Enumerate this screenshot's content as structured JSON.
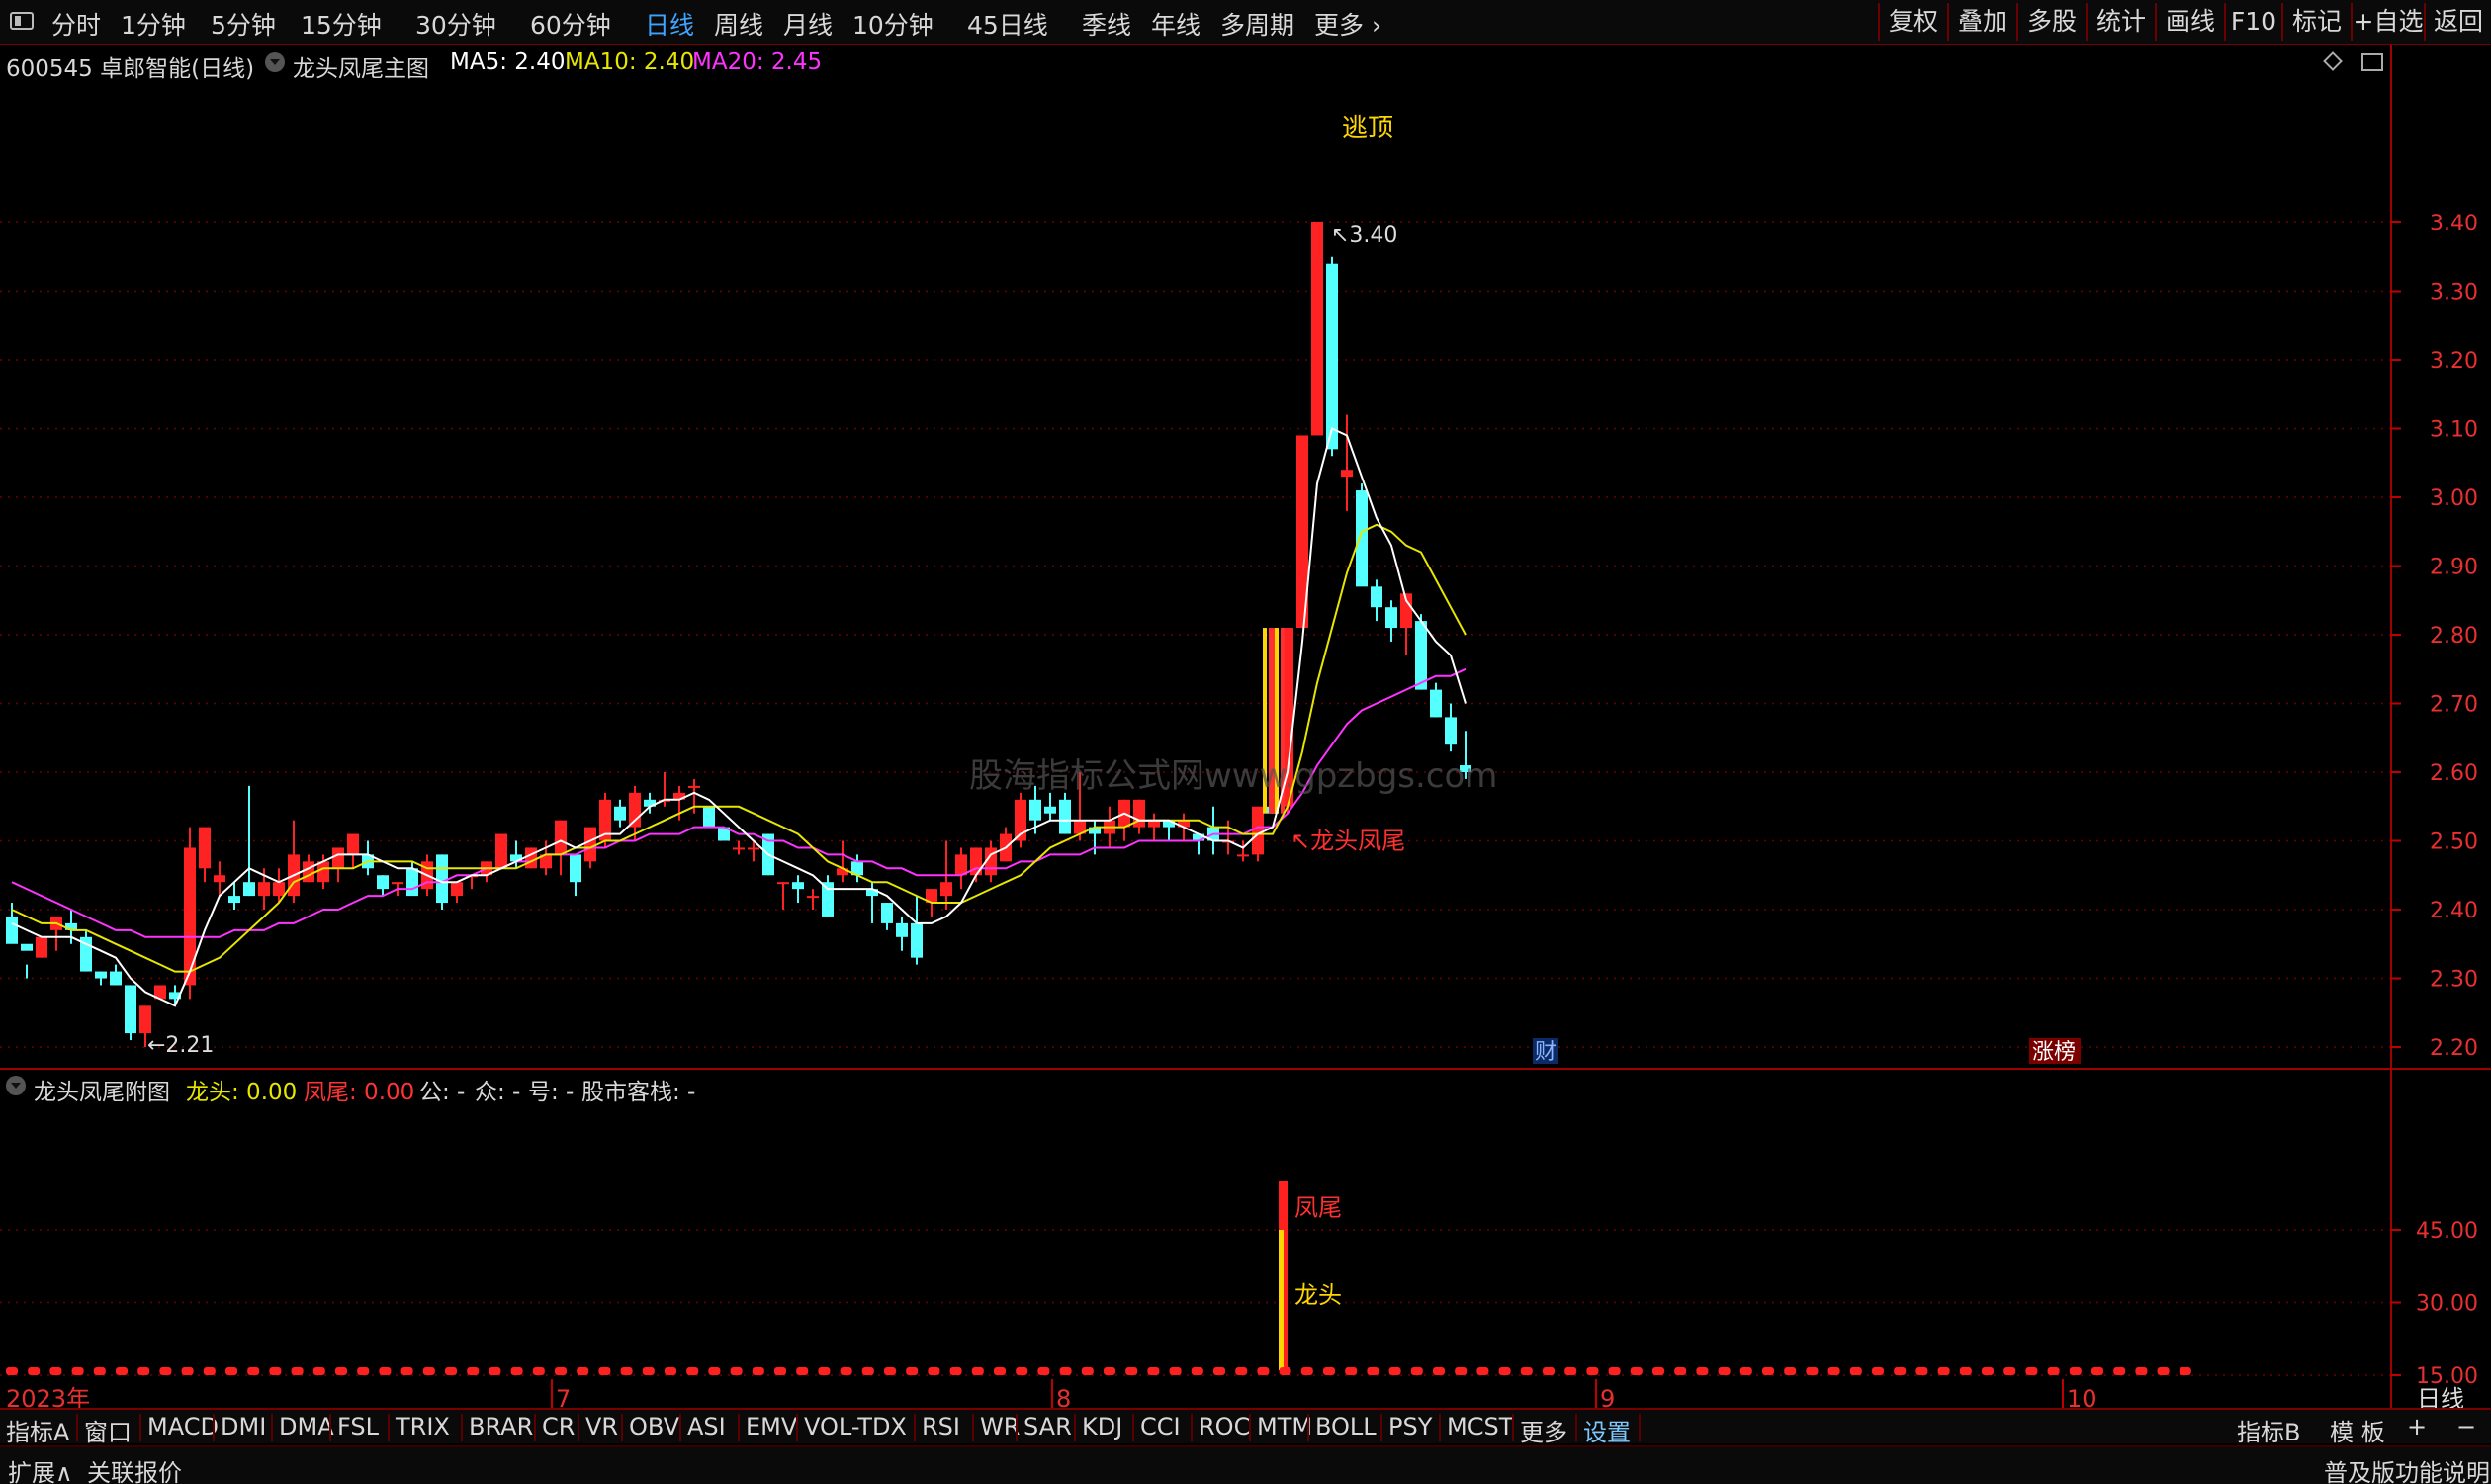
{
  "toolbar": {
    "periods": [
      "分时",
      "1分钟",
      "5分钟",
      "15分钟",
      "30分钟",
      "60分钟",
      "日线",
      "周线",
      "月线",
      "10分钟",
      "45日线",
      "季线",
      "年线",
      "多周期",
      "更多"
    ],
    "active_period": "日线",
    "right_buttons": [
      "复权",
      "叠加",
      "多股",
      "统计",
      "画线",
      "F10",
      "标记",
      "+自选",
      "返回"
    ]
  },
  "main_chart": {
    "stock": "600545 卓郎智能(日线)",
    "indicator_name": "龙头凤尾主图",
    "ma5_label": "MA5: 2.40",
    "ma10_label": "MA10: 2.40",
    "ma20_label": "MA20: 2.45",
    "annotation_top": "逃顶",
    "high_label": "3.40",
    "low_label": "2.21",
    "signal_label": "↖龙头凤尾",
    "watermark": "股海指标公式网www.gpzbgs.com",
    "event_finance": "财",
    "event_limit": "涨榜"
  },
  "sub_chart": {
    "title": "龙头凤尾附图",
    "longtou_label": "龙头: 0.00",
    "fengwei_label": "凤尾: 0.00",
    "gong_label": "公: -",
    "zhong_label": "众: -",
    "hao_label": "号: -",
    "gushi_label": "股市客栈: -",
    "bar_label_top": "凤尾",
    "bar_label_mid": "龙头"
  },
  "time_axis": {
    "year": "2023年",
    "months": [
      "7",
      "8",
      "9",
      "10"
    ],
    "period_right": "日线"
  },
  "chart_data": {
    "type": "candlestick",
    "main_y_ticks": [
      3.4,
      3.3,
      3.2,
      3.1,
      3.0,
      2.9,
      2.8,
      2.7,
      2.6,
      2.5,
      2.4,
      2.3,
      2.2
    ],
    "main_ylim": [
      2.17,
      3.45
    ],
    "sub_y_ticks": [
      45.0,
      30.0,
      15.0
    ],
    "sub_ylim": [
      0,
      57
    ],
    "candles": [
      [
        2.39,
        2.41,
        2.36,
        2.35
      ],
      [
        2.35,
        2.32,
        2.3,
        2.34
      ],
      [
        2.33,
        2.35,
        2.33,
        2.36
      ],
      [
        2.37,
        2.38,
        2.34,
        2.39
      ],
      [
        2.38,
        2.4,
        2.35,
        2.37
      ],
      [
        2.36,
        2.37,
        2.31,
        2.31
      ],
      [
        2.31,
        2.31,
        2.29,
        2.3
      ],
      [
        2.31,
        2.32,
        2.29,
        2.29
      ],
      [
        2.29,
        2.29,
        2.21,
        2.22
      ],
      [
        2.22,
        2.24,
        2.2,
        2.26
      ],
      [
        2.27,
        2.24,
        2.24,
        2.29
      ],
      [
        2.28,
        2.29,
        2.26,
        2.27
      ],
      [
        2.29,
        2.52,
        2.27,
        2.49
      ],
      [
        2.46,
        2.52,
        2.44,
        2.52
      ],
      [
        2.44,
        2.47,
        2.42,
        2.45
      ],
      [
        2.42,
        2.44,
        2.4,
        2.41
      ],
      [
        2.44,
        2.58,
        2.42,
        2.42
      ],
      [
        2.42,
        2.46,
        2.4,
        2.44
      ],
      [
        2.42,
        2.46,
        2.41,
        2.44
      ],
      [
        2.42,
        2.53,
        2.41,
        2.48
      ],
      [
        2.44,
        2.48,
        2.44,
        2.47
      ],
      [
        2.44,
        2.48,
        2.43,
        2.47
      ],
      [
        2.46,
        2.48,
        2.44,
        2.49
      ],
      [
        2.48,
        2.51,
        2.46,
        2.51
      ],
      [
        2.48,
        2.5,
        2.45,
        2.46
      ],
      [
        2.45,
        2.45,
        2.42,
        2.43
      ],
      [
        2.44,
        2.44,
        2.42,
        2.44
      ],
      [
        2.46,
        2.47,
        2.43,
        2.42
      ],
      [
        2.43,
        2.48,
        2.42,
        2.47
      ],
      [
        2.48,
        2.48,
        2.4,
        2.41
      ],
      [
        2.42,
        2.44,
        2.41,
        2.44
      ],
      [
        2.45,
        2.45,
        2.43,
        2.45
      ],
      [
        2.45,
        2.47,
        2.44,
        2.47
      ],
      [
        2.46,
        2.51,
        2.46,
        2.51
      ],
      [
        2.48,
        2.5,
        2.46,
        2.47
      ],
      [
        2.46,
        2.49,
        2.46,
        2.49
      ],
      [
        2.46,
        2.5,
        2.45,
        2.48
      ],
      [
        2.48,
        2.53,
        2.45,
        2.53
      ],
      [
        2.48,
        2.48,
        2.42,
        2.44
      ],
      [
        2.47,
        2.51,
        2.46,
        2.52
      ],
      [
        2.5,
        2.57,
        2.49,
        2.56
      ],
      [
        2.55,
        2.56,
        2.52,
        2.53
      ],
      [
        2.52,
        2.58,
        2.5,
        2.57
      ],
      [
        2.56,
        2.57,
        2.54,
        2.55
      ],
      [
        2.56,
        2.6,
        2.55,
        2.56
      ],
      [
        2.56,
        2.58,
        2.53,
        2.57
      ],
      [
        2.58,
        2.59,
        2.54,
        2.58
      ],
      [
        2.55,
        2.55,
        2.52,
        2.52
      ],
      [
        2.52,
        2.52,
        2.5,
        2.5
      ],
      [
        2.49,
        2.5,
        2.48,
        2.49
      ],
      [
        2.49,
        2.5,
        2.47,
        2.49
      ],
      [
        2.51,
        2.51,
        2.45,
        2.45
      ],
      [
        2.44,
        2.44,
        2.4,
        2.44
      ],
      [
        2.44,
        2.45,
        2.41,
        2.43
      ],
      [
        2.42,
        2.43,
        2.4,
        2.42
      ],
      [
        2.44,
        2.45,
        2.39,
        2.39
      ],
      [
        2.45,
        2.5,
        2.44,
        2.46
      ],
      [
        2.47,
        2.48,
        2.44,
        2.45
      ],
      [
        2.43,
        2.44,
        2.38,
        2.42
      ],
      [
        2.41,
        2.41,
        2.37,
        2.38
      ],
      [
        2.38,
        2.39,
        2.34,
        2.36
      ],
      [
        2.38,
        2.42,
        2.32,
        2.33
      ],
      [
        2.41,
        2.43,
        2.39,
        2.43
      ],
      [
        2.42,
        2.5,
        2.4,
        2.44
      ],
      [
        2.45,
        2.49,
        2.43,
        2.48
      ],
      [
        2.45,
        2.49,
        2.44,
        2.49
      ],
      [
        2.45,
        2.5,
        2.44,
        2.49
      ],
      [
        2.47,
        2.52,
        2.47,
        2.51
      ],
      [
        2.5,
        2.57,
        2.49,
        2.56
      ],
      [
        2.56,
        2.58,
        2.51,
        2.53
      ],
      [
        2.55,
        2.57,
        2.53,
        2.54
      ],
      [
        2.56,
        2.57,
        2.51,
        2.51
      ],
      [
        2.51,
        2.6,
        2.5,
        2.53
      ],
      [
        2.52,
        2.53,
        2.48,
        2.51
      ],
      [
        2.51,
        2.55,
        2.49,
        2.53
      ],
      [
        2.52,
        2.56,
        2.5,
        2.56
      ],
      [
        2.52,
        2.56,
        2.51,
        2.56
      ],
      [
        2.52,
        2.54,
        2.5,
        2.53
      ],
      [
        2.53,
        2.53,
        2.5,
        2.52
      ],
      [
        2.52,
        2.54,
        2.5,
        2.53
      ],
      [
        2.51,
        2.51,
        2.48,
        2.5
      ],
      [
        2.52,
        2.55,
        2.48,
        2.5
      ],
      [
        2.5,
        2.53,
        2.48,
        2.5
      ],
      [
        2.48,
        2.5,
        2.47,
        2.48
      ],
      [
        2.48,
        2.55,
        2.47,
        2.55
      ],
      [
        2.55,
        2.62,
        2.54,
        2.54
      ],
      [
        2.55,
        2.81,
        2.54,
        2.81
      ],
      [
        2.81,
        3.09,
        2.81,
        3.09
      ],
      [
        3.09,
        3.4,
        3.09,
        3.4
      ],
      [
        3.34,
        3.35,
        3.06,
        3.07
      ],
      [
        3.03,
        3.12,
        2.98,
        3.04
      ],
      [
        3.01,
        3.02,
        2.88,
        2.87
      ],
      [
        2.87,
        2.88,
        2.82,
        2.84
      ],
      [
        2.84,
        2.85,
        2.79,
        2.81
      ],
      [
        2.81,
        2.86,
        2.77,
        2.86
      ],
      [
        2.82,
        2.83,
        2.72,
        2.72
      ],
      [
        2.72,
        2.73,
        2.68,
        2.68
      ],
      [
        2.68,
        2.7,
        2.63,
        2.64
      ],
      [
        2.61,
        2.66,
        2.59,
        2.6
      ]
    ],
    "candle_order": "open,high,low,close",
    "ma5": [
      2.38,
      2.37,
      2.36,
      2.36,
      2.36,
      2.35,
      2.34,
      2.33,
      2.3,
      2.28,
      2.27,
      2.26,
      2.31,
      2.37,
      2.42,
      2.44,
      2.46,
      2.45,
      2.44,
      2.45,
      2.46,
      2.47,
      2.48,
      2.48,
      2.48,
      2.47,
      2.46,
      2.46,
      2.45,
      2.44,
      2.44,
      2.45,
      2.45,
      2.46,
      2.47,
      2.48,
      2.49,
      2.5,
      2.49,
      2.5,
      2.51,
      2.51,
      2.53,
      2.55,
      2.56,
      2.56,
      2.57,
      2.56,
      2.54,
      2.52,
      2.5,
      2.48,
      2.47,
      2.46,
      2.45,
      2.43,
      2.43,
      2.43,
      2.43,
      2.42,
      2.4,
      2.38,
      2.38,
      2.39,
      2.41,
      2.45,
      2.48,
      2.49,
      2.51,
      2.52,
      2.53,
      2.53,
      2.53,
      2.53,
      2.53,
      2.54,
      2.53,
      2.53,
      2.53,
      2.52,
      2.51,
      2.5,
      2.5,
      2.49,
      2.51,
      2.52,
      2.6,
      2.79,
      3.02,
      3.1,
      3.09,
      3.03,
      2.97,
      2.93,
      2.85,
      2.82,
      2.79,
      2.77,
      2.7
    ],
    "ma10": [
      2.4,
      2.39,
      2.38,
      2.38,
      2.37,
      2.37,
      2.36,
      2.35,
      2.34,
      2.33,
      2.32,
      2.31,
      2.31,
      2.32,
      2.33,
      2.35,
      2.37,
      2.39,
      2.41,
      2.44,
      2.45,
      2.46,
      2.46,
      2.46,
      2.47,
      2.47,
      2.47,
      2.47,
      2.46,
      2.46,
      2.46,
      2.46,
      2.46,
      2.46,
      2.46,
      2.47,
      2.48,
      2.48,
      2.49,
      2.49,
      2.5,
      2.5,
      2.51,
      2.52,
      2.53,
      2.54,
      2.55,
      2.55,
      2.55,
      2.55,
      2.54,
      2.53,
      2.52,
      2.51,
      2.49,
      2.47,
      2.46,
      2.45,
      2.44,
      2.44,
      2.43,
      2.42,
      2.41,
      2.41,
      2.41,
      2.42,
      2.43,
      2.44,
      2.45,
      2.47,
      2.49,
      2.5,
      2.51,
      2.52,
      2.52,
      2.52,
      2.53,
      2.53,
      2.53,
      2.53,
      2.53,
      2.52,
      2.52,
      2.51,
      2.51,
      2.51,
      2.55,
      2.63,
      2.73,
      2.81,
      2.89,
      2.95,
      2.96,
      2.95,
      2.93,
      2.92,
      2.88,
      2.84,
      2.8
    ],
    "ma20": [
      2.44,
      2.43,
      2.42,
      2.41,
      2.4,
      2.39,
      2.38,
      2.37,
      2.37,
      2.36,
      2.36,
      2.36,
      2.36,
      2.36,
      2.36,
      2.37,
      2.37,
      2.37,
      2.38,
      2.38,
      2.39,
      2.4,
      2.4,
      2.41,
      2.42,
      2.42,
      2.43,
      2.43,
      2.44,
      2.44,
      2.45,
      2.45,
      2.46,
      2.46,
      2.47,
      2.47,
      2.48,
      2.48,
      2.48,
      2.49,
      2.49,
      2.5,
      2.5,
      2.51,
      2.51,
      2.51,
      2.52,
      2.52,
      2.52,
      2.51,
      2.51,
      2.5,
      2.5,
      2.49,
      2.49,
      2.48,
      2.48,
      2.47,
      2.47,
      2.46,
      2.46,
      2.45,
      2.45,
      2.45,
      2.45,
      2.46,
      2.46,
      2.46,
      2.47,
      2.47,
      2.48,
      2.48,
      2.48,
      2.49,
      2.49,
      2.49,
      2.5,
      2.5,
      2.5,
      2.5,
      2.5,
      2.51,
      2.51,
      2.51,
      2.52,
      2.52,
      2.54,
      2.57,
      2.61,
      2.64,
      2.67,
      2.69,
      2.7,
      2.71,
      2.72,
      2.73,
      2.74,
      2.74,
      2.75
    ],
    "signal_bar_index": 85,
    "sub_bar_values": {
      "longtou": 45,
      "fengwei": 55
    }
  },
  "bottom_tabs": [
    "指标A",
    "窗口",
    "MACD",
    "DMI",
    "DMA",
    "FSL",
    "TRIX",
    "BRAR",
    "CR",
    "VR",
    "OBV",
    "ASI",
    "EMV",
    "VOL-TDX",
    "RSI",
    "WR",
    "SAR",
    "KDJ",
    "CCI",
    "ROC",
    "MTM",
    "BOLL",
    "PSY",
    "MCST",
    "更多",
    "设置"
  ],
  "bottom_right_tabs": [
    "指标B",
    "模 板",
    "+",
    "−"
  ],
  "bottom_bar": {
    "expand": "扩展∧",
    "related": "关联报价",
    "right": "普及版功能说明"
  },
  "colors": {
    "up": "#ff2222",
    "down": "#54ffff",
    "ma5": "#ffffff",
    "ma10": "#e6e600",
    "ma20": "#ff33ff",
    "grid": "#7a0000"
  }
}
